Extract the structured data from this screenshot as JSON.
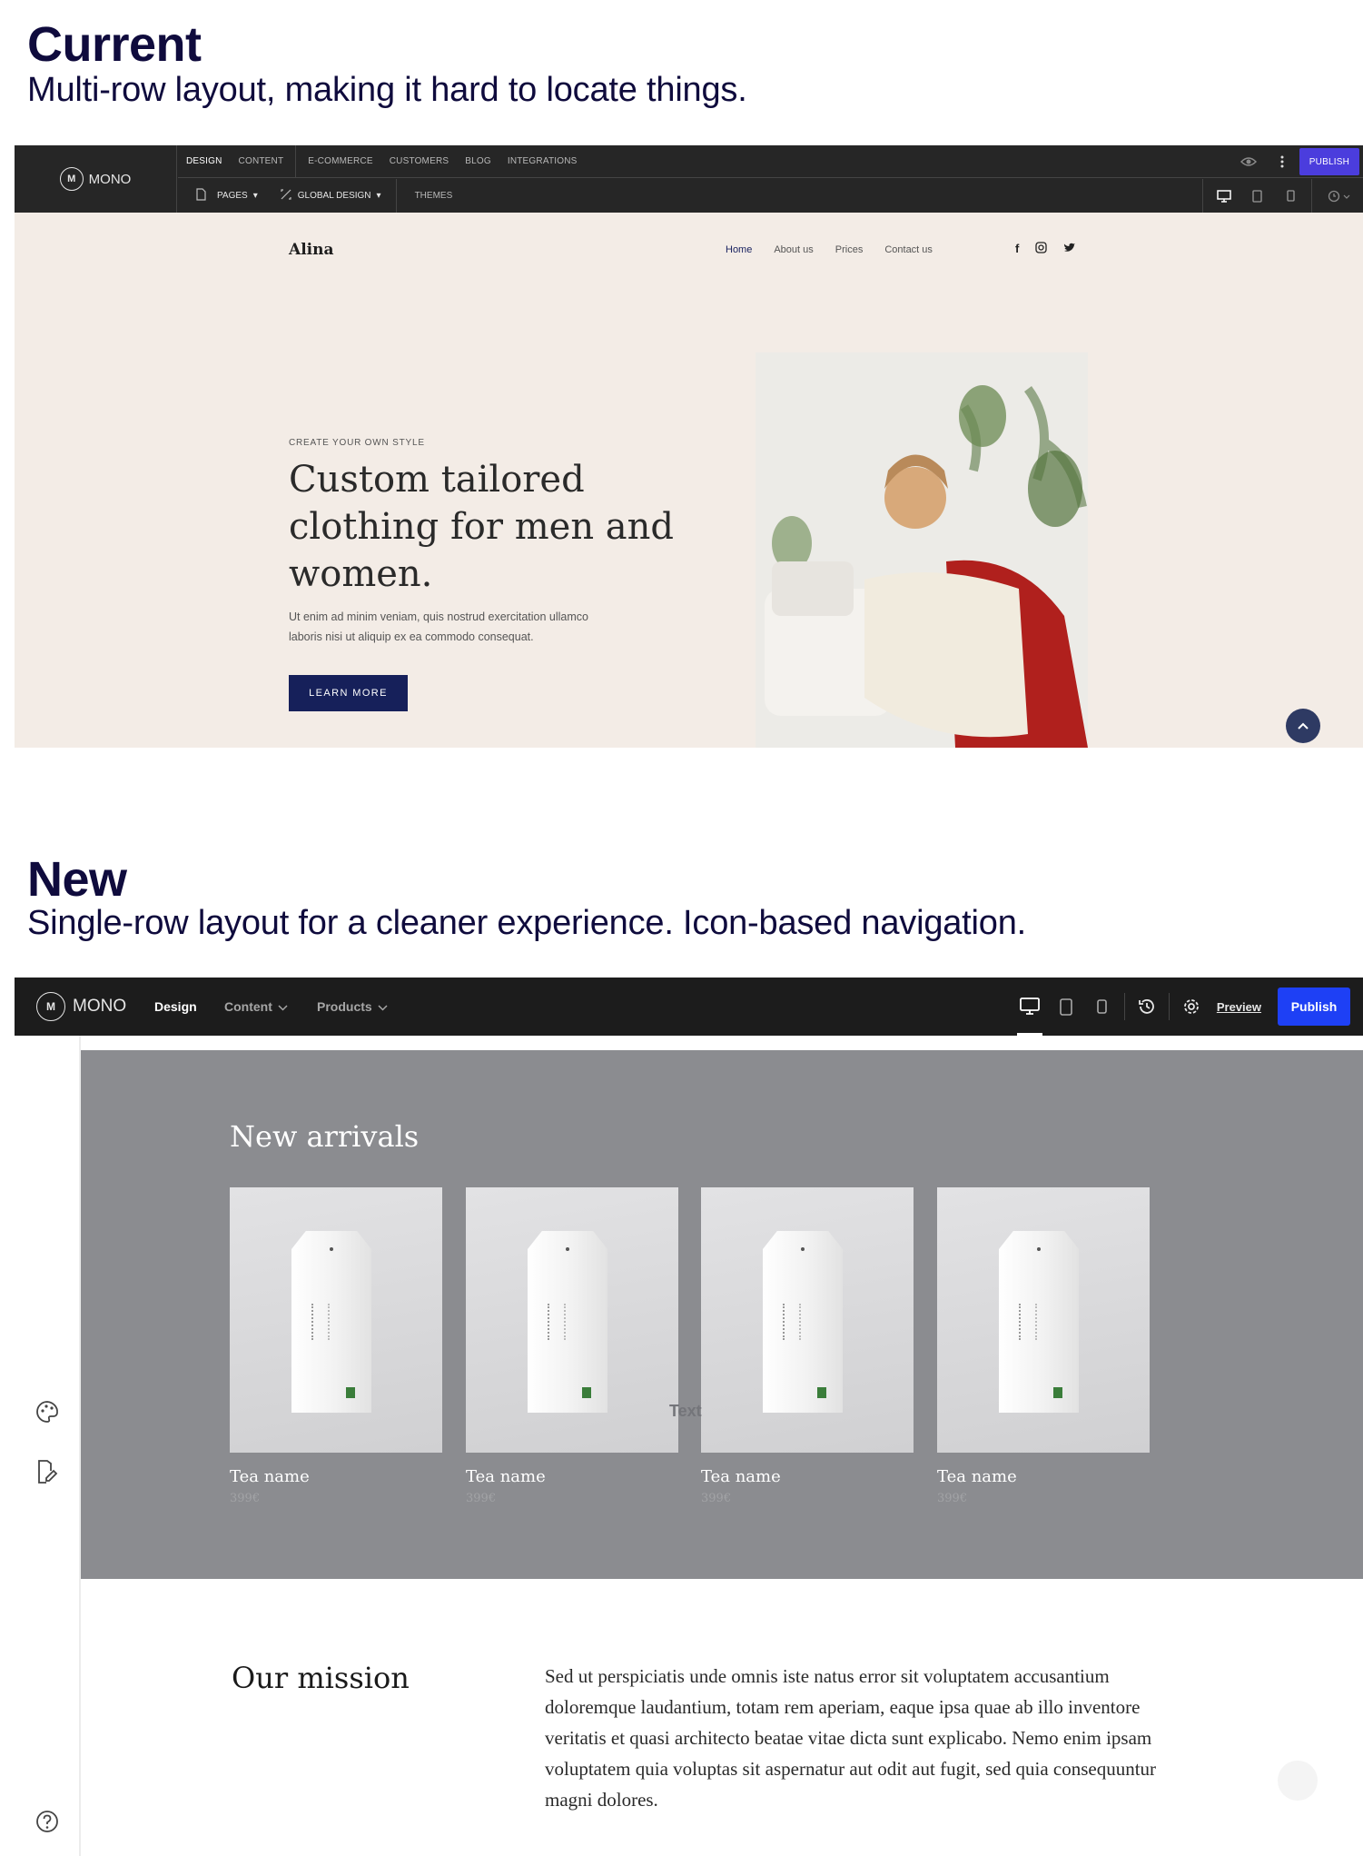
{
  "current": {
    "heading": "Current",
    "subheading": "Multi-row layout, making it hard to locate things.",
    "toolbar": {
      "logo_mark": "M",
      "logo_text": "MONO",
      "tabs": [
        "DESIGN",
        "CONTENT",
        "E-COMMERCE",
        "CUSTOMERS",
        "BLOG",
        "INTEGRATIONS"
      ],
      "active_tab": "DESIGN",
      "publish_label": "PUBLISH",
      "pages_label": "PAGES",
      "global_design_label": "GLOBAL DESIGN",
      "themes_label": "THEMES"
    },
    "site": {
      "brand": "Alina",
      "nav": [
        "Home",
        "About us",
        "Prices",
        "Contact us"
      ],
      "eyebrow": "CREATE YOUR OWN STYLE",
      "title": "Custom tailored clothing for men and women.",
      "text": "Ut enim ad minim veniam, quis nostrud exercitation ullamco laboris nisi ut aliquip ex ea commodo consequat.",
      "button": "LEARN MORE"
    }
  },
  "new": {
    "heading": "New",
    "subheading": "Single-row layout for a cleaner experience. Icon-based navigation.",
    "toolbar": {
      "logo_mark": "M",
      "logo_text": "MONO",
      "tabs": [
        "Design",
        "Content",
        "Products"
      ],
      "preview_label": "Preview",
      "publish_label": "Publish"
    },
    "arrivals": {
      "title": "New arrivals",
      "ghost_text": "Text",
      "products": [
        {
          "name": "Tea name",
          "price": "399€"
        },
        {
          "name": "Tea name",
          "price": "399€"
        },
        {
          "name": "Tea name",
          "price": "399€"
        },
        {
          "name": "Tea name",
          "price": "399€"
        }
      ]
    },
    "mission": {
      "title": "Our mission",
      "text": "Sed ut perspiciatis unde omnis iste natus error sit voluptatem accusantium doloremque laudantium, totam rem aperiam, eaque ipsa quae ab illo inventore veritatis et quasi architecto beatae vitae dicta sunt explicabo. Nemo enim ipsam voluptatem quia voluptas sit aspernatur aut odit aut fugit, sed quia consequuntur magni dolores."
    }
  },
  "colors": {
    "brand_blue": "#1e40f5",
    "old_publish": "#4b3ddd",
    "navy": "#16205a",
    "toolbar_dark": "#1c1c1c",
    "hero_bg": "#f3ece6",
    "arrivals_bg": "#8b8c90"
  },
  "icons": [
    "eye-icon",
    "more-icon",
    "page-icon",
    "design-icon",
    "desktop-icon",
    "tablet-icon",
    "mobile-icon",
    "history-icon",
    "settings-icon",
    "palette-icon",
    "edit-page-icon",
    "help-icon",
    "facebook-icon",
    "instagram-icon",
    "twitter-icon",
    "chevron-up-icon"
  ]
}
